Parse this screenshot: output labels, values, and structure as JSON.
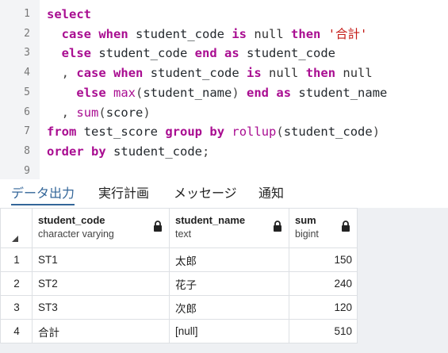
{
  "editor": {
    "line_numbers": [
      "1",
      "2",
      "3",
      "4",
      "5",
      "6",
      "7",
      "8",
      "9"
    ],
    "tokens": {
      "select": "select",
      "case": "case",
      "when": "when",
      "student_code": "student_code",
      "is": "is",
      "null": "null",
      "then": "then",
      "total_str": "'合計'",
      "else": "else",
      "end": "end",
      "as": "as",
      "comma": ",",
      "max": "max",
      "paren_open": "(",
      "paren_close": ")",
      "student_name": "student_name",
      "sum": "sum",
      "score": "score",
      "from": "from",
      "test_score": "test_score",
      "group": "group",
      "by": "by",
      "rollup": "rollup",
      "order": "order",
      "semicolon": ";"
    }
  },
  "tabs": [
    {
      "label": "データ出力",
      "active": true
    },
    {
      "label": "実行計画",
      "active": false
    },
    {
      "label": "メッセージ",
      "active": false
    },
    {
      "label": "通知",
      "active": false
    }
  ],
  "grid": {
    "columns": [
      {
        "name": "student_code",
        "type": "character varying"
      },
      {
        "name": "student_name",
        "type": "text"
      },
      {
        "name": "sum",
        "type": "bigint"
      }
    ],
    "rows": [
      {
        "num": "1",
        "code": "ST1",
        "name": "太郎",
        "sum": "150"
      },
      {
        "num": "2",
        "code": "ST2",
        "name": "花子",
        "sum": "240"
      },
      {
        "num": "3",
        "code": "ST3",
        "name": "次郎",
        "sum": "120"
      },
      {
        "num": "4",
        "code": "合計",
        "name": "[null]",
        "sum": "510"
      }
    ]
  },
  "colors": {
    "keyword": "#a90d91",
    "string": "#c41a16",
    "active_tab": "#336699",
    "null_value": "#6b7d9a"
  },
  "icons": [
    "lock-icon",
    "sort-indicator-icon"
  ]
}
